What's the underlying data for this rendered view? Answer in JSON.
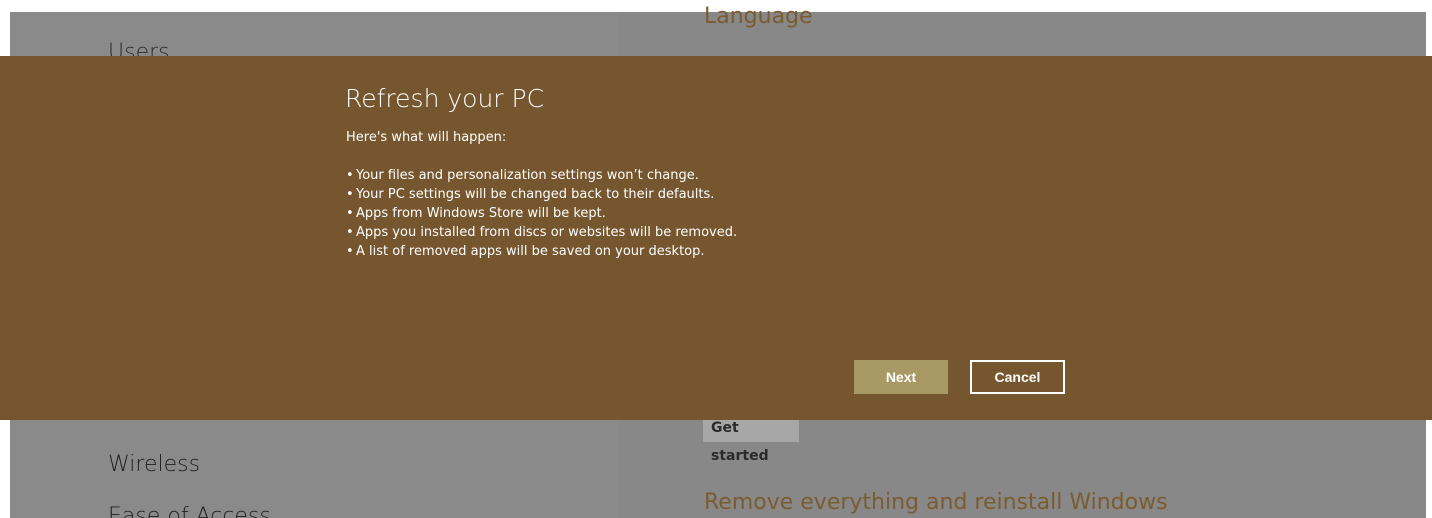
{
  "background": {
    "left_items": {
      "users": "Users",
      "wireless": "Wireless",
      "ease_of_access": "Ease of Access"
    },
    "right_sections": {
      "language_heading": "Language",
      "get_started_button": "Get started",
      "remove_heading": "Remove everything and reinstall Windows"
    }
  },
  "dialog": {
    "title": "Refresh your PC",
    "subtitle": "Here's what will happen:",
    "bullets": [
      "Your files and personalization settings won’t change.",
      "Your PC settings will be changed back to their defaults.",
      "Apps from Windows Store will be kept.",
      "Apps you installed from discs or websites will be removed.",
      "A list of removed apps will be saved on your desktop."
    ],
    "buttons": {
      "next": "Next",
      "cancel": "Cancel"
    }
  },
  "colors": {
    "dialog_background": "#76562e",
    "accent_button": "#a99965",
    "heading_accent": "#7a5c30",
    "dim_overlay": "#8a8a8a"
  }
}
